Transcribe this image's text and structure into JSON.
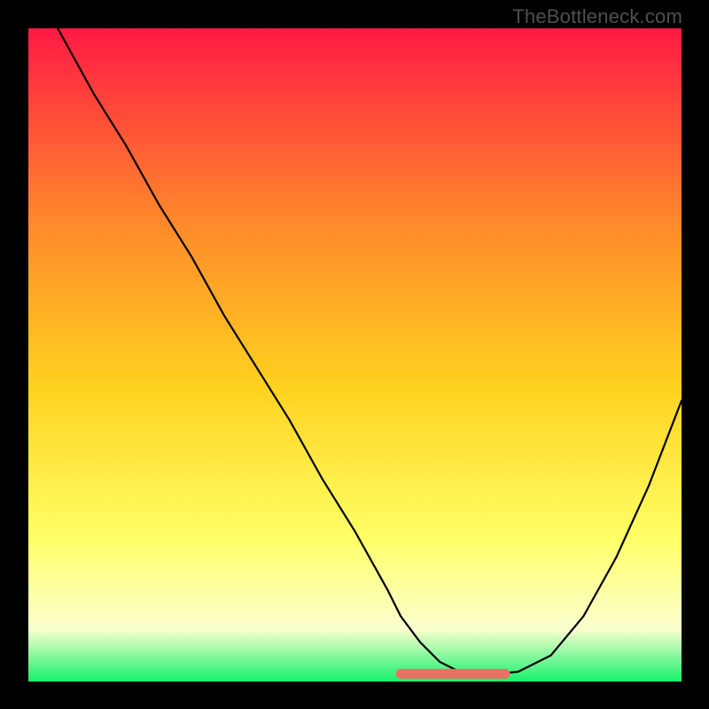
{
  "watermark": "TheBottleneck.com",
  "colors": {
    "frame": "#000000",
    "curve": "#000000",
    "accent": "#e97163",
    "gradient_top": "#ff1a44",
    "gradient_mid1": "#ff8a2b",
    "gradient_mid2": "#ffd21f",
    "gradient_mid3": "#ffff66",
    "gradient_mid4": "#fbffd0",
    "gradient_bottom": "#17f16b"
  },
  "chart_data": {
    "type": "line",
    "title": "",
    "xlabel": "",
    "ylabel": "",
    "xlim": [
      0,
      100
    ],
    "ylim": [
      0,
      100
    ],
    "x": [
      4.5,
      10,
      15,
      20,
      25,
      30,
      35,
      40,
      45,
      50,
      55,
      57,
      60,
      63,
      66,
      69,
      72,
      75,
      80,
      85,
      90,
      95,
      100
    ],
    "values": [
      100,
      90,
      82,
      73,
      65,
      56,
      48,
      40,
      31,
      23,
      14,
      10,
      6,
      3,
      1.5,
      1,
      1.2,
      1.5,
      4,
      10,
      19,
      30,
      43
    ],
    "accent_segment": {
      "x_start": 57,
      "x_end": 73,
      "y": 1.2
    }
  }
}
